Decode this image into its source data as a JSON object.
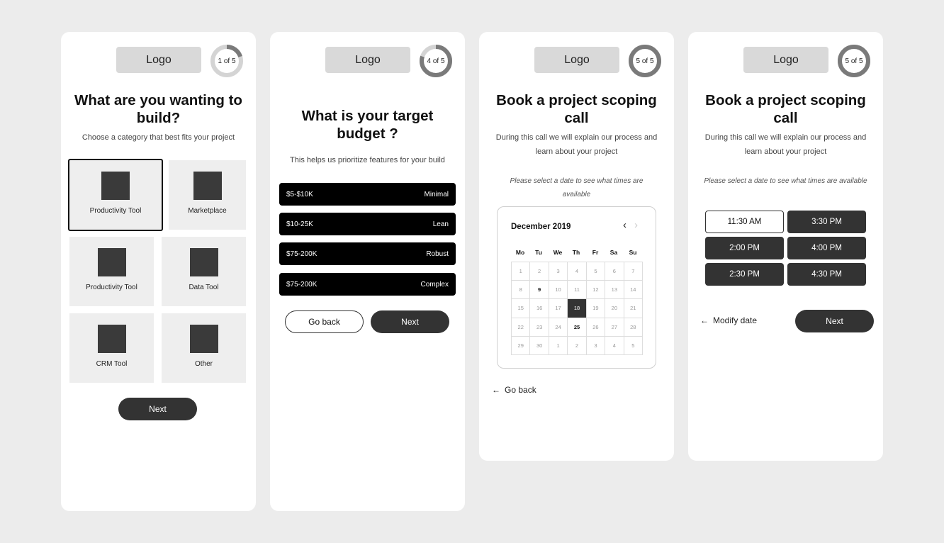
{
  "screen1": {
    "logo": "Logo",
    "progress": "1 of 5",
    "progress_fraction": 0.2,
    "title": "What are you wanting to build?",
    "subtitle": "Choose a category that best fits your project",
    "categories": [
      {
        "label": "Productivity Tool",
        "selected": true
      },
      {
        "label": "Marketplace"
      },
      {
        "label": "Productivity Tool"
      },
      {
        "label": "Data Tool"
      },
      {
        "label": "CRM Tool"
      },
      {
        "label": "Other"
      }
    ],
    "next_label": "Next"
  },
  "screen2": {
    "logo": "Logo",
    "progress": "4 of 5",
    "progress_fraction": 0.8,
    "title": "What is your target budget ?",
    "subtitle": "This helps us prioritize features for your build",
    "budgets": [
      {
        "range": "$5-$10K",
        "tier": "Minimal"
      },
      {
        "range": "$10-25K",
        "tier": "Lean"
      },
      {
        "range": "$75-200K",
        "tier": "Robust"
      },
      {
        "range": "$75-200K",
        "tier": "Complex"
      }
    ],
    "back_label": "Go back",
    "next_label": "Next"
  },
  "screen3": {
    "logo": "Logo",
    "progress": "5 of 5",
    "progress_fraction": 1.0,
    "title": "Book a project scoping call",
    "subtitle": "During this call we will explain our process and learn about your project",
    "hint": "Please select a date to see what times are available",
    "calendar": {
      "month": "December 2019",
      "prev_icon": "chevron-left",
      "next_icon": "chevron-right",
      "weekdays": [
        "Mo",
        "Tu",
        "We",
        "Th",
        "Fr",
        "Sa",
        "Su"
      ],
      "days": [
        "1",
        "2",
        "3",
        "4",
        "5",
        "6",
        "7",
        "8",
        "9",
        "10",
        "11",
        "12",
        "13",
        "14",
        "15",
        "16",
        "17",
        "18",
        "19",
        "20",
        "21",
        "22",
        "23",
        "24",
        "25",
        "26",
        "27",
        "28",
        "29",
        "30",
        "1",
        "2",
        "3",
        "4",
        "5"
      ],
      "selected_day": "18",
      "available_days": [
        "9",
        "25"
      ]
    },
    "back_label": "Go back"
  },
  "screen4": {
    "logo": "Logo",
    "progress": "5 of 5",
    "progress_fraction": 1.0,
    "title": "Book a project scoping call",
    "subtitle": "During this call we will explain our process and learn about your project",
    "hint": "Please select a date to see what times are available",
    "times": [
      {
        "label": "11:30 AM",
        "selected": true
      },
      {
        "label": "3:30 PM"
      },
      {
        "label": "2:00 PM"
      },
      {
        "label": "4:00 PM"
      },
      {
        "label": "2:30 PM"
      },
      {
        "label": "4:30 PM"
      }
    ],
    "modify_label": "Modify date",
    "next_label": "Next"
  },
  "colors": {
    "dark": "#333333",
    "tile": "#eeeeee",
    "ring_track": "#d4d4d4",
    "ring_fill": "#7a7a7a"
  }
}
